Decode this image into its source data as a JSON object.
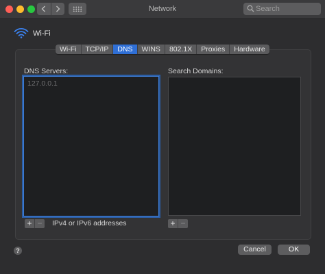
{
  "window": {
    "title": "Network"
  },
  "titlebar": {
    "traffic_lights": [
      "#ff5f57",
      "#febc2e",
      "#28c840"
    ],
    "back_icon": "chevron-left-icon",
    "forward_icon": "chevron-right-icon",
    "grid_icon": "grid-icon"
  },
  "search": {
    "placeholder": "Search",
    "icon": "search-icon"
  },
  "interface": {
    "name": "Wi-Fi",
    "icon": "wifi-icon"
  },
  "tabs": [
    {
      "label": "Wi-Fi",
      "active": false
    },
    {
      "label": "TCP/IP",
      "active": false
    },
    {
      "label": "DNS",
      "active": true
    },
    {
      "label": "WINS",
      "active": false
    },
    {
      "label": "802.1X",
      "active": false
    },
    {
      "label": "Proxies",
      "active": false
    },
    {
      "label": "Hardware",
      "active": false
    }
  ],
  "dns": {
    "label": "DNS Servers:",
    "entries": [
      "127.0.0.1"
    ],
    "add": "+",
    "remove": "−",
    "hint": "IPv4 or IPv6 addresses"
  },
  "search_domains": {
    "label": "Search Domains:",
    "entries": [],
    "add": "+",
    "remove": "−"
  },
  "footer": {
    "help": "?",
    "cancel": "Cancel",
    "ok": "OK"
  },
  "colors": {
    "accent": "#2f6fd6",
    "focus_ring": "#3f7fd9",
    "background": "#2d2d2f"
  }
}
